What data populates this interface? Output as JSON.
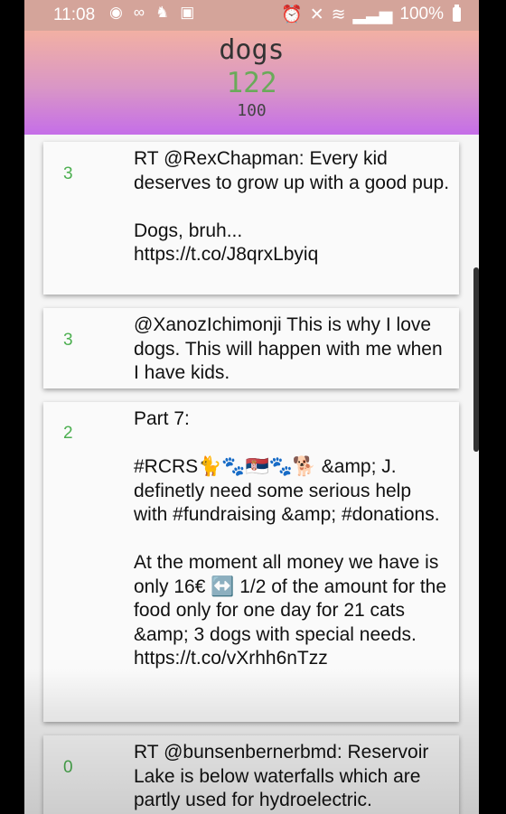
{
  "status_bar": {
    "time": "11:08",
    "left_icons": [
      "spotify-icon",
      "voicemail-icon",
      "notification-icon",
      "screenshot-icon"
    ],
    "battery": "100%"
  },
  "header": {
    "title": "dogs",
    "count": "122",
    "sub": "100"
  },
  "tweets": [
    {
      "score": "3",
      "text": "RT @RexChapman: Every kid deserves to grow up with a good pup.\n\nDogs, bruh...\nhttps://t.co/J8qrxLbyiq"
    },
    {
      "score": "3",
      "text": "@XanozIchimonji This is why I love dogs. This will happen with me when I have kids."
    },
    {
      "score": "2",
      "text": "Part 7:\n\n#RCRS🐈🐾🇷🇸🐾🐕 &amp; J. definetly need some serious help with #fundraising &amp; #donations.\n\nAt the moment all money we have is only 16€ ↔️ 1/2 of the amount for the food only for one day for 21 cats &amp; 3 dogs with special needs.\nhttps://t.co/vXrhh6nTzz"
    },
    {
      "score": "0",
      "text": "RT @bunsenbernerbmd: Reservoir Lake is below waterfalls which are partly used for hydroelectric."
    }
  ]
}
